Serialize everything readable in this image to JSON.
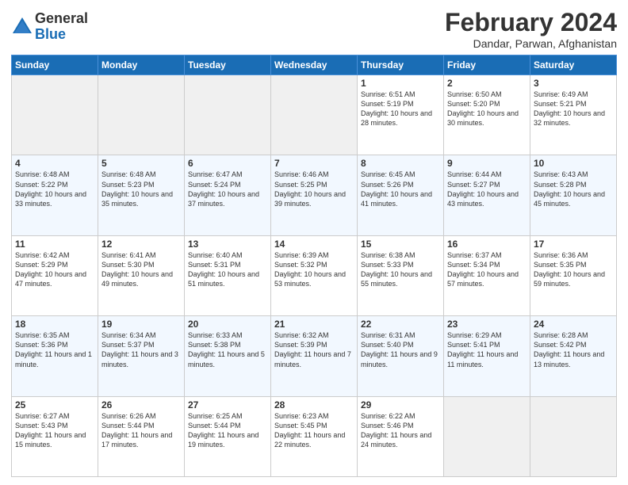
{
  "logo": {
    "general": "General",
    "blue": "Blue"
  },
  "header": {
    "title": "February 2024",
    "location": "Dandar, Parwan, Afghanistan"
  },
  "days_of_week": [
    "Sunday",
    "Monday",
    "Tuesday",
    "Wednesday",
    "Thursday",
    "Friday",
    "Saturday"
  ],
  "weeks": [
    [
      {
        "day": "",
        "info": ""
      },
      {
        "day": "",
        "info": ""
      },
      {
        "day": "",
        "info": ""
      },
      {
        "day": "",
        "info": ""
      },
      {
        "day": "1",
        "sunrise": "6:51 AM",
        "sunset": "5:19 PM",
        "daylight": "10 hours and 28 minutes."
      },
      {
        "day": "2",
        "sunrise": "6:50 AM",
        "sunset": "5:20 PM",
        "daylight": "10 hours and 30 minutes."
      },
      {
        "day": "3",
        "sunrise": "6:49 AM",
        "sunset": "5:21 PM",
        "daylight": "10 hours and 32 minutes."
      }
    ],
    [
      {
        "day": "4",
        "sunrise": "6:48 AM",
        "sunset": "5:22 PM",
        "daylight": "10 hours and 33 minutes."
      },
      {
        "day": "5",
        "sunrise": "6:48 AM",
        "sunset": "5:23 PM",
        "daylight": "10 hours and 35 minutes."
      },
      {
        "day": "6",
        "sunrise": "6:47 AM",
        "sunset": "5:24 PM",
        "daylight": "10 hours and 37 minutes."
      },
      {
        "day": "7",
        "sunrise": "6:46 AM",
        "sunset": "5:25 PM",
        "daylight": "10 hours and 39 minutes."
      },
      {
        "day": "8",
        "sunrise": "6:45 AM",
        "sunset": "5:26 PM",
        "daylight": "10 hours and 41 minutes."
      },
      {
        "day": "9",
        "sunrise": "6:44 AM",
        "sunset": "5:27 PM",
        "daylight": "10 hours and 43 minutes."
      },
      {
        "day": "10",
        "sunrise": "6:43 AM",
        "sunset": "5:28 PM",
        "daylight": "10 hours and 45 minutes."
      }
    ],
    [
      {
        "day": "11",
        "sunrise": "6:42 AM",
        "sunset": "5:29 PM",
        "daylight": "10 hours and 47 minutes."
      },
      {
        "day": "12",
        "sunrise": "6:41 AM",
        "sunset": "5:30 PM",
        "daylight": "10 hours and 49 minutes."
      },
      {
        "day": "13",
        "sunrise": "6:40 AM",
        "sunset": "5:31 PM",
        "daylight": "10 hours and 51 minutes."
      },
      {
        "day": "14",
        "sunrise": "6:39 AM",
        "sunset": "5:32 PM",
        "daylight": "10 hours and 53 minutes."
      },
      {
        "day": "15",
        "sunrise": "6:38 AM",
        "sunset": "5:33 PM",
        "daylight": "10 hours and 55 minutes."
      },
      {
        "day": "16",
        "sunrise": "6:37 AM",
        "sunset": "5:34 PM",
        "daylight": "10 hours and 57 minutes."
      },
      {
        "day": "17",
        "sunrise": "6:36 AM",
        "sunset": "5:35 PM",
        "daylight": "10 hours and 59 minutes."
      }
    ],
    [
      {
        "day": "18",
        "sunrise": "6:35 AM",
        "sunset": "5:36 PM",
        "daylight": "11 hours and 1 minute."
      },
      {
        "day": "19",
        "sunrise": "6:34 AM",
        "sunset": "5:37 PM",
        "daylight": "11 hours and 3 minutes."
      },
      {
        "day": "20",
        "sunrise": "6:33 AM",
        "sunset": "5:38 PM",
        "daylight": "11 hours and 5 minutes."
      },
      {
        "day": "21",
        "sunrise": "6:32 AM",
        "sunset": "5:39 PM",
        "daylight": "11 hours and 7 minutes."
      },
      {
        "day": "22",
        "sunrise": "6:31 AM",
        "sunset": "5:40 PM",
        "daylight": "11 hours and 9 minutes."
      },
      {
        "day": "23",
        "sunrise": "6:29 AM",
        "sunset": "5:41 PM",
        "daylight": "11 hours and 11 minutes."
      },
      {
        "day": "24",
        "sunrise": "6:28 AM",
        "sunset": "5:42 PM",
        "daylight": "11 hours and 13 minutes."
      }
    ],
    [
      {
        "day": "25",
        "sunrise": "6:27 AM",
        "sunset": "5:43 PM",
        "daylight": "11 hours and 15 minutes."
      },
      {
        "day": "26",
        "sunrise": "6:26 AM",
        "sunset": "5:44 PM",
        "daylight": "11 hours and 17 minutes."
      },
      {
        "day": "27",
        "sunrise": "6:25 AM",
        "sunset": "5:44 PM",
        "daylight": "11 hours and 19 minutes."
      },
      {
        "day": "28",
        "sunrise": "6:23 AM",
        "sunset": "5:45 PM",
        "daylight": "11 hours and 22 minutes."
      },
      {
        "day": "29",
        "sunrise": "6:22 AM",
        "sunset": "5:46 PM",
        "daylight": "11 hours and 24 minutes."
      },
      {
        "day": "",
        "info": ""
      },
      {
        "day": "",
        "info": ""
      }
    ]
  ]
}
